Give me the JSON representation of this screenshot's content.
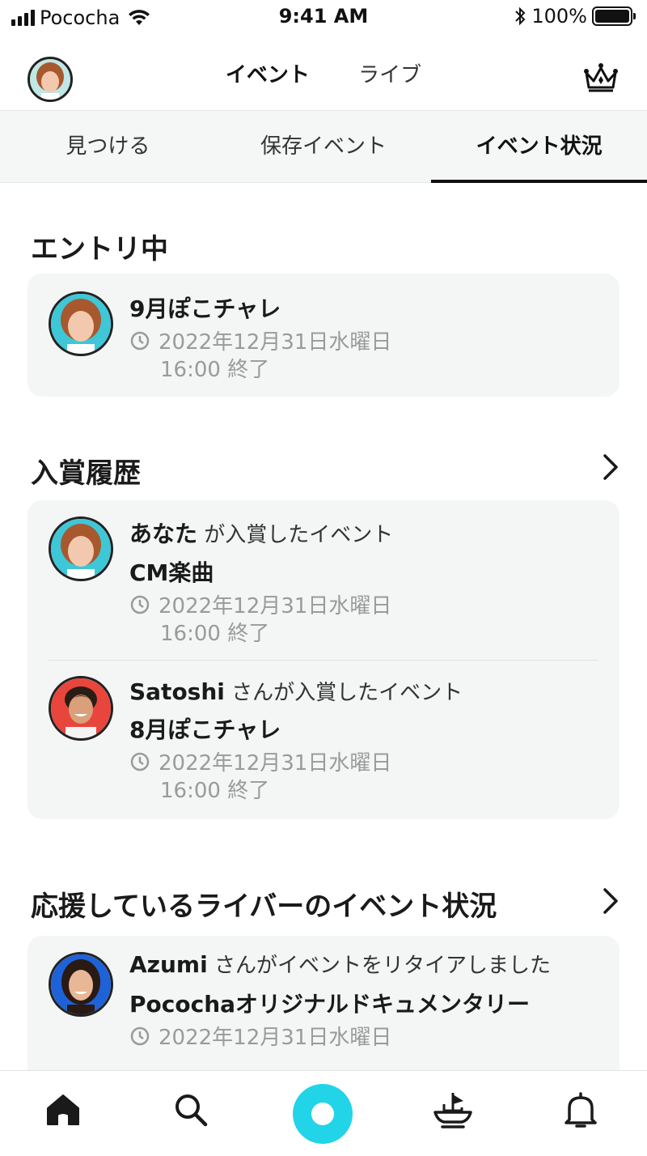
{
  "status_bar": {
    "carrier": "Pococha",
    "time": "9:41 AM",
    "battery": "100%"
  },
  "header": {
    "tabs": [
      {
        "label": "イベント",
        "active": true
      },
      {
        "label": "ライブ",
        "active": false
      }
    ]
  },
  "subtabs": [
    {
      "label": "見つける",
      "active": false
    },
    {
      "label": "保存イベント",
      "active": false
    },
    {
      "label": "イベント状況",
      "active": true
    }
  ],
  "entry_section": {
    "title": "エントリ中",
    "items": [
      {
        "event": "9月ぽこチャレ",
        "date": "2022年12月31日水曜日",
        "end": "16:00 終了"
      }
    ]
  },
  "award_section": {
    "title": "入賞履歴",
    "items": [
      {
        "who": "あなた",
        "suffix": " が入賞したイベント",
        "event": "CM楽曲",
        "date": "2022年12月31日水曜日",
        "end": "16:00 終了"
      },
      {
        "who": "Satoshi",
        "suffix": " さんが入賞したイベント",
        "event": "8月ぽこチャレ",
        "date": "2022年12月31日水曜日",
        "end": "16:00 終了"
      }
    ]
  },
  "support_section": {
    "title": "応援しているライバーのイベント状況",
    "items": [
      {
        "who": "Azumi",
        "suffix": " さんがイベントをリタイアしました",
        "event": "Pocochaオリジナルドキュメンタリー",
        "date": "2022年12月31日水曜日"
      }
    ]
  },
  "colors": {
    "accent": "#22d4e8",
    "card_bg": "#f4f5f5",
    "muted_text": "#9a9a9a"
  },
  "bottom_nav": [
    "home-icon",
    "search-icon",
    "live-button",
    "ship-icon",
    "bell-icon"
  ]
}
